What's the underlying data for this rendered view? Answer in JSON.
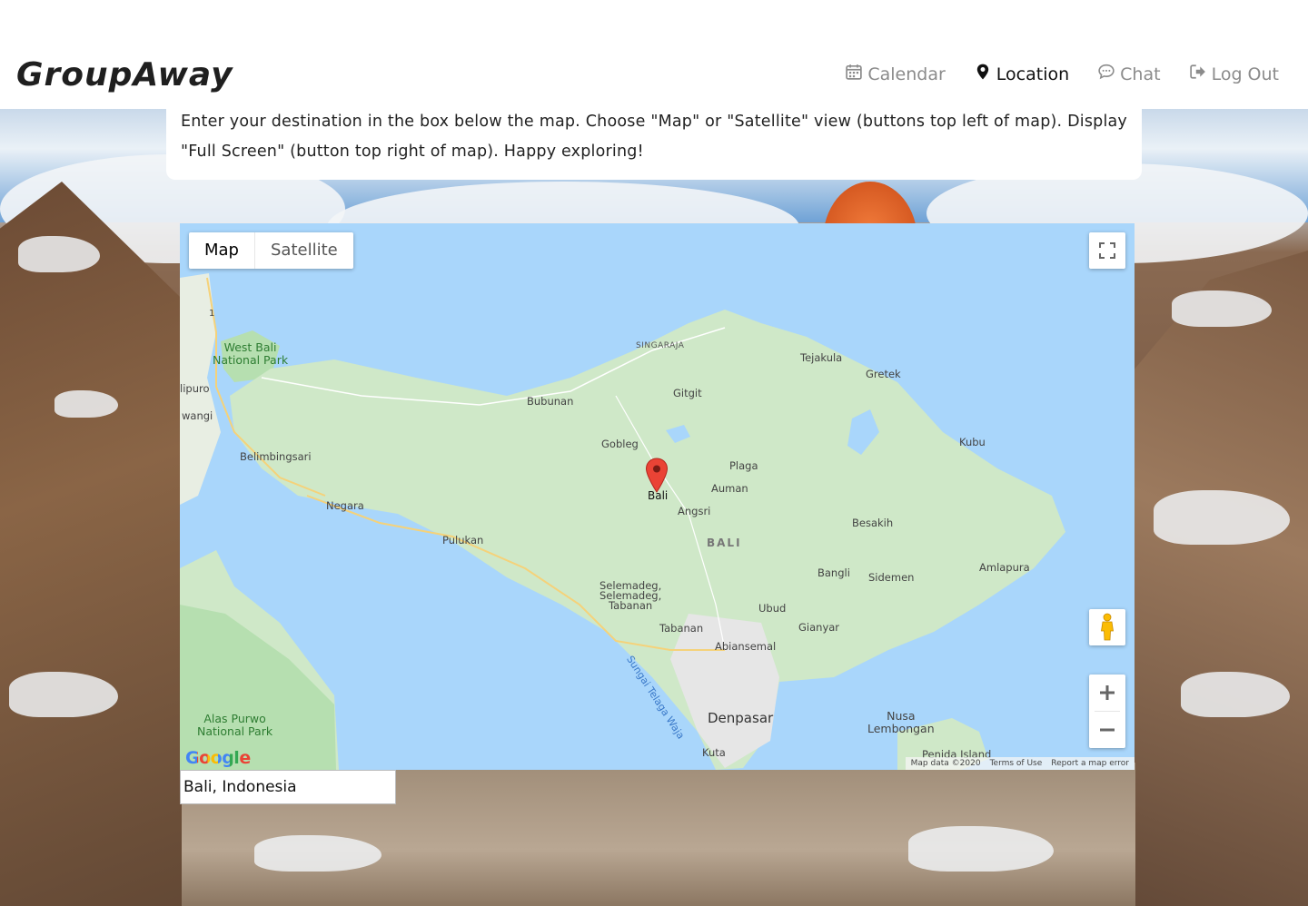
{
  "brand": "GroupAway",
  "nav": {
    "calendar": "Calendar",
    "location": "Location",
    "chat": "Chat",
    "logout": "Log Out",
    "active": "location"
  },
  "info_text": "Enter your destination in the box below the map. Choose \"Map\" or \"Satellite\" view (buttons top left of map). Display \"Full Screen\" (button top right of map). Happy exploring!",
  "map": {
    "type_buttons": {
      "map": "Map",
      "satellite": "Satellite",
      "selected": "Map"
    },
    "marker_label": "Bali",
    "labels": {
      "singaraja": "SINGARAJA",
      "tejakula": "Tejakula",
      "gretek": "Gretek",
      "west_bali_1": "West Bali",
      "west_bali_2": "National Park",
      "lipuro": "lipuro",
      "wangi": "wangi",
      "bubunan": "Bubunan",
      "gitgit": "Gitgit",
      "gobleg": "Gobleg",
      "kubu": "Kubu",
      "belimbingsari": "Belimbingsari",
      "plaga": "Plaga",
      "auman": "Auman",
      "angsri": "Angsri",
      "negara": "Negara",
      "besakih": "Besakih",
      "pulukan": "Pulukan",
      "bali_region": "BALI",
      "amlapura": "Amlapura",
      "bangli": "Bangli",
      "sidemen": "Sidemen",
      "selemadeg_1": "Selemadeg,",
      "selemadeg_2": "Selemadeg,",
      "selemadeg_3": "Tabanan",
      "ubud": "Ubud",
      "tabanan": "Tabanan",
      "gianyar": "Gianyar",
      "abiansemal": "Abiansemal",
      "river": "Sungai Telaga Waja",
      "denpasar": "Denpasar",
      "nusa_1": "Nusa",
      "nusa_2": "Lembongan",
      "alas_1": "Alas Purwo",
      "alas_2": "National Park",
      "kuta": "Kuta",
      "penida": "Penida Island",
      "road_number": "1"
    },
    "google": "Google",
    "attribution": {
      "data": "Map data ©2020",
      "terms": "Terms of Use",
      "report": "Report a map error"
    },
    "colors": {
      "water": "#a9d6fb",
      "land": "#cfe8c8",
      "park": "#b6dfb0",
      "urban": "#e8e8e8"
    }
  },
  "destination_input": {
    "value": "Bali, Indonesia"
  }
}
